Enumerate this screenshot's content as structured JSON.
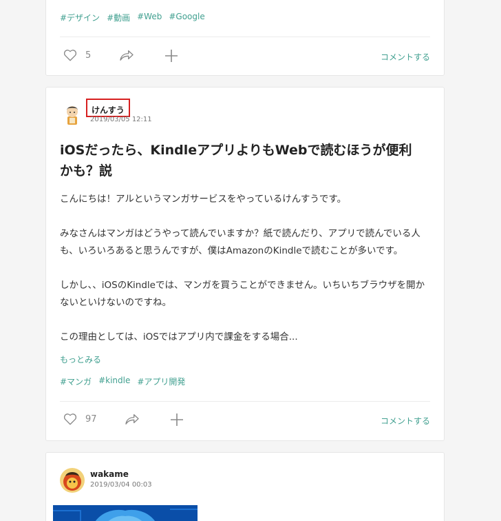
{
  "posts": [
    {
      "tags": [
        "#デザイン",
        "#動画",
        "#Web",
        "#Google"
      ],
      "likes": "5",
      "comment_label": "コメントする"
    },
    {
      "author": "けんすう",
      "date": "2019/03/05 12:11",
      "title": "iOSだったら、KindleアプリよりもWebで読むほうが便利かも？説",
      "body": [
        "こんにちは！アルというマンガサービスをやっているけんすうです。",
        "みなさんはマンガはどうやって読んでいますか？紙で読んだり、アプリで読んでいる人も、いろいろあると思うんですが、僕はAmazonのKindleで読むことが多いです。",
        "しかし、、iOSのKindleでは、マンガを買うことができません。いちいちブラウザを開かないといけないのですね。",
        "この理由としては、iOSではアプリ内で課金をする場合..."
      ],
      "more_label": "もっとみる",
      "tags": [
        "#マンガ",
        "#kindle",
        "#アプリ開発"
      ],
      "likes": "97",
      "comment_label": "コメントする"
    },
    {
      "author": "wakame",
      "date": "2019/03/04 00:03"
    }
  ],
  "icons": {
    "like": "heart-icon",
    "share": "share-arrow-icon",
    "add": "plus-icon"
  },
  "colors": {
    "accent": "#41a090",
    "highlight_box": "#d71f1f",
    "icon": "#888888",
    "page_bg": "#f5f5f5"
  }
}
